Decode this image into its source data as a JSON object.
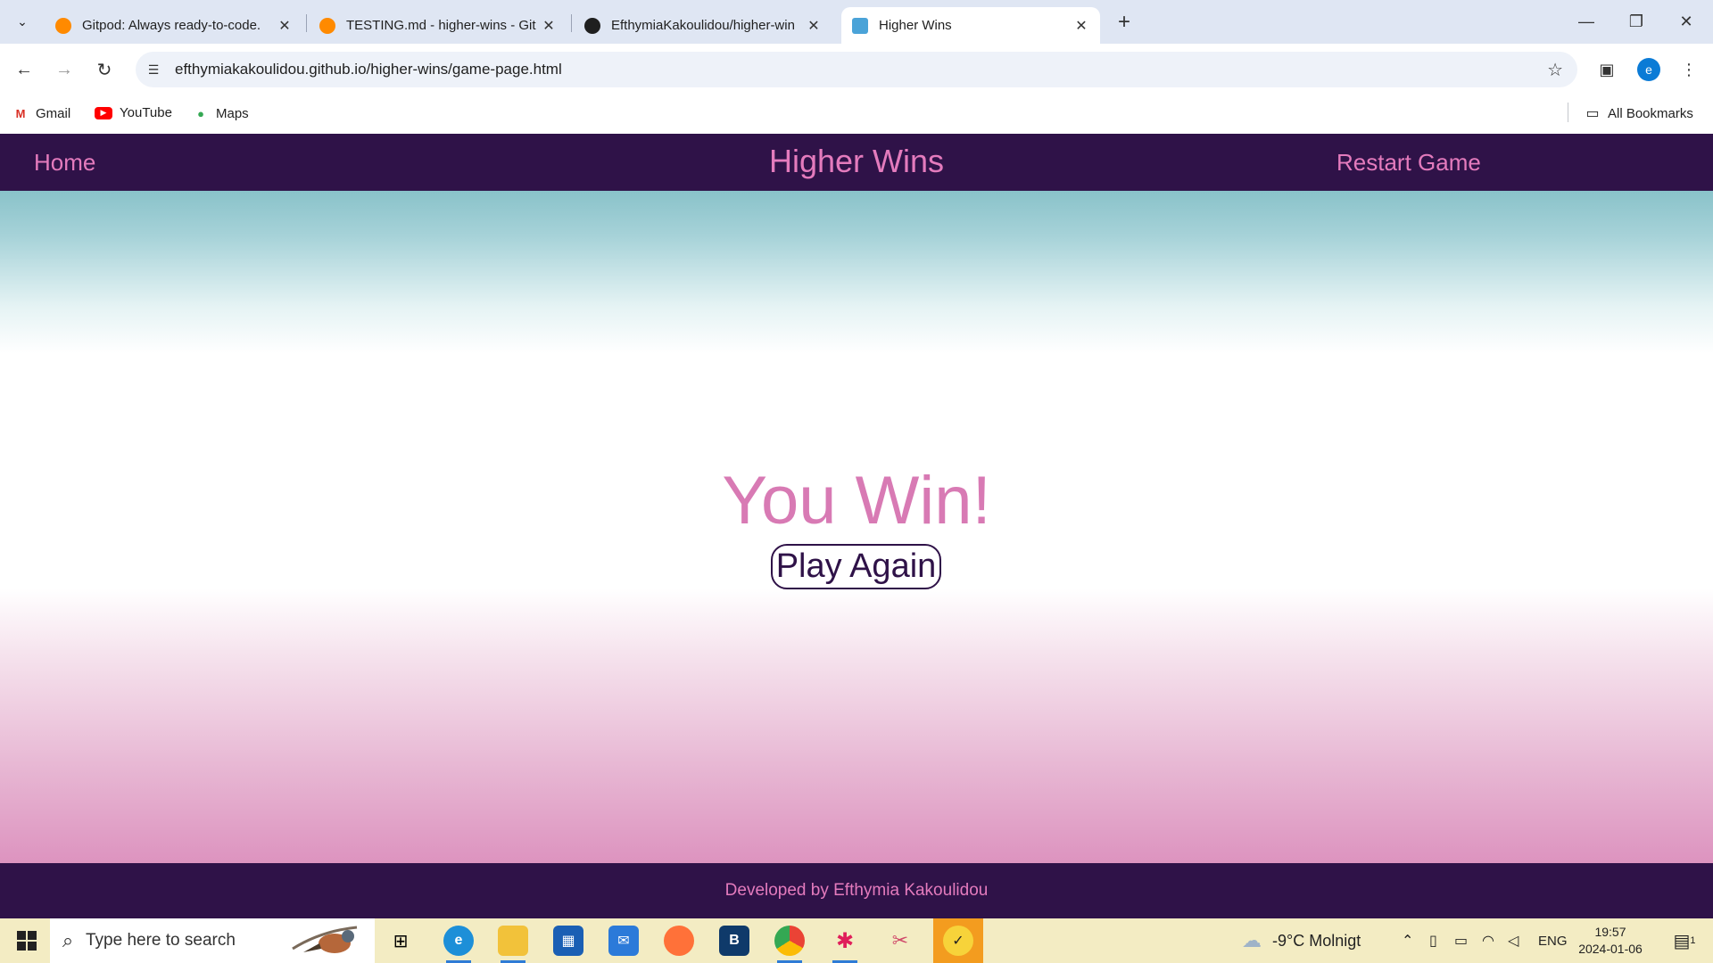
{
  "browser": {
    "tabs": [
      {
        "title": "Gitpod: Always ready-to-code.",
        "favicon": "gitpod-icon",
        "color": "#ff8a00"
      },
      {
        "title": "TESTING.md - higher-wins - Git",
        "favicon": "gitpod-icon",
        "color": "#ff8a00"
      },
      {
        "title": "EfthymiaKakoulidou/higher-win",
        "favicon": "github-icon",
        "color": "#1f1f1f"
      },
      {
        "title": "Higher Wins",
        "favicon": "page-icon",
        "color": "#4aa3d8"
      }
    ],
    "url": "efthymiakakoulidou.github.io/higher-wins/game-page.html",
    "profile_initial": "e",
    "bookmarks": [
      {
        "label": "Gmail",
        "icon": "gmail-icon"
      },
      {
        "label": "YouTube",
        "icon": "youtube-icon"
      },
      {
        "label": "Maps",
        "icon": "maps-icon"
      }
    ],
    "all_bookmarks": "All Bookmarks"
  },
  "site": {
    "nav": {
      "home": "Home",
      "brand": "Higher Wins",
      "restart": "Restart Game"
    },
    "result": "You Win!",
    "play_again": "Play Again",
    "footer": "Developed by Efthymia Kakoulidou"
  },
  "taskbar": {
    "search_placeholder": "Type here to search",
    "weather": "-9°C  Molnigt",
    "language": "ENG",
    "time": "19:57",
    "date": "2024-01-06",
    "notifications": "1"
  },
  "colors": {
    "brand_dark": "#2f1248",
    "brand_pink": "#e47bbd",
    "taskbar": "#f3ecc3"
  }
}
